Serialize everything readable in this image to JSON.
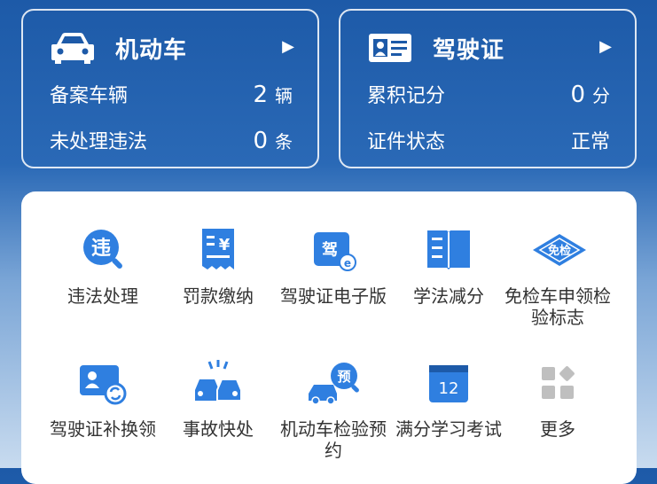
{
  "vehicle_card": {
    "title": "机动车",
    "arrow": "▶",
    "rows": [
      {
        "label": "备案车辆",
        "value": "2",
        "unit": "辆"
      },
      {
        "label": "未处理违法",
        "value": "0",
        "unit": "条"
      }
    ]
  },
  "license_card": {
    "title": "驾驶证",
    "arrow": "▶",
    "rows": [
      {
        "label": "累积记分",
        "value": "0",
        "unit": "分"
      },
      {
        "label": "证件状态",
        "value": "正常",
        "unit": ""
      }
    ]
  },
  "services": [
    {
      "label": "违法处理",
      "icon": "violation-search-icon",
      "glyph": "违"
    },
    {
      "label": "罚款缴纳",
      "icon": "receipt-yuan-icon",
      "glyph": "¥"
    },
    {
      "label": "驾驶证电子版",
      "icon": "e-license-icon",
      "glyph": "驾"
    },
    {
      "label": "学法减分",
      "icon": "open-book-icon",
      "glyph": ""
    },
    {
      "label": "免检车申领检验标志",
      "icon": "inspection-exempt-icon",
      "glyph": "免检"
    },
    {
      "label": "驾驶证补换领",
      "icon": "license-replace-icon",
      "glyph": ""
    },
    {
      "label": "事故快处",
      "icon": "accident-cars-icon",
      "glyph": ""
    },
    {
      "label": "机动车检验预约",
      "icon": "inspection-appointment-icon",
      "glyph": "预"
    },
    {
      "label": "满分学习考试",
      "icon": "calendar-12-icon",
      "glyph": "12"
    },
    {
      "label": "更多",
      "icon": "more-grid-icon",
      "glyph": ""
    }
  ],
  "colors": {
    "accent": "#2f7fe0",
    "bg_top": "#1d5aa8"
  }
}
